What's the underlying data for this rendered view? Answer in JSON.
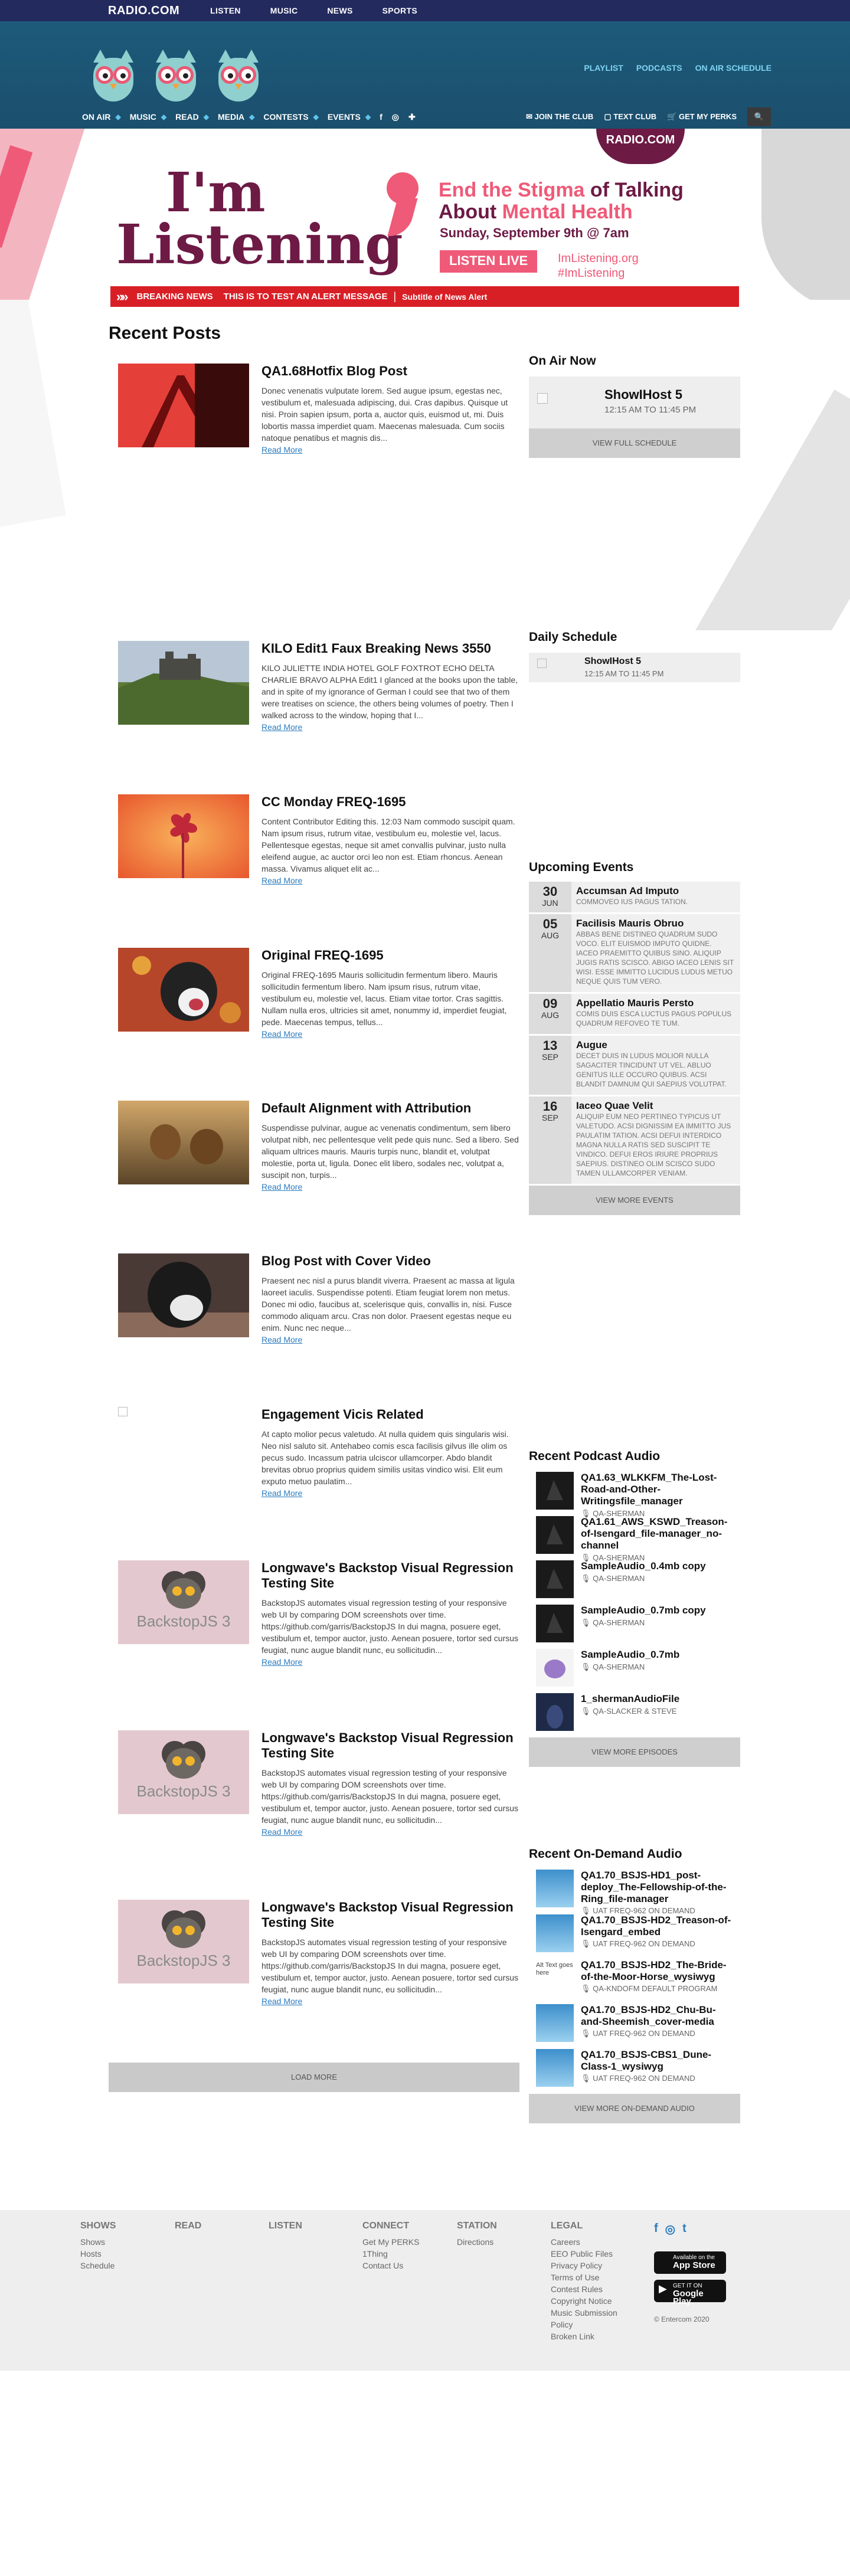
{
  "topbar": {
    "brand": "RADIO.COM",
    "items": [
      "LISTEN",
      "MUSIC",
      "NEWS",
      "SPORTS"
    ]
  },
  "header": {
    "links": [
      "PLAYLIST",
      "PODCASTS",
      "ON AIR SCHEDULE"
    ],
    "nav": [
      "ON AIR",
      "MUSIC",
      "READ",
      "MEDIA",
      "CONTESTS",
      "EVENTS"
    ],
    "social": [
      "f",
      "◎",
      "✚"
    ],
    "right": [
      "JOIN THE CLUB",
      "TEXT CLUB",
      "GET MY PERKS"
    ],
    "search_icon": "🔍"
  },
  "hero": {
    "radio": "RADIO.COM",
    "im": "I'm",
    "listening": "Listening",
    "tag1": "End the Stigma",
    "tag2": " of Talking About ",
    "tag3": "Mental Health",
    "date": "Sunday, September 9th @ 7am",
    "listen_live": "LISTEN LIVE",
    "url1": "ImListening.org",
    "url2": "#ImListening"
  },
  "alert": {
    "label": "BREAKING NEWS",
    "message": "THIS IS TO TEST AN ALERT MESSAGE",
    "separator": "|",
    "subtitle": "Subtitle of News Alert"
  },
  "recent_posts": {
    "title": "Recent Posts",
    "read_more": "Read More",
    "load_more": "LOAD MORE",
    "posts": [
      {
        "title": "QA1.68Hotfix Blog Post",
        "body": "Donec venenatis vulputate lorem. Sed augue ipsum, egestas nec, vestibulum et, malesuada adipiscing, dui. Cras dapibus. Quisque ut nisi. Proin sapien ipsum, porta a, auctor quis, euismod ut, mi. Duis lobortis massa imperdiet quam. Maecenas malesuada. Cum sociis natoque penatibus et magnis dis..."
      },
      {
        "title": "KILO Edit1 Faux Breaking News 3550",
        "body": "KILO JULIETTE INDIA HOTEL GOLF FOXTROT ECHO DELTA CHARLIE BRAVO ALPHA Edit1 I glanced at the books upon the table, and in spite of my ignorance of German I could see that two of them were treatises on science, the others being volumes of poetry. Then I walked across to the window, hoping that I..."
      },
      {
        "title": "CC Monday FREQ-1695",
        "body": "Content Contributor Editing this. 12:03 Nam commodo suscipit quam. Nam ipsum risus, rutrum vitae, vestibulum eu, molestie vel, lacus. Pellentesque egestas, neque sit amet convallis pulvinar, justo nulla eleifend augue, ac auctor orci leo non est. Etiam rhoncus. Aenean massa. Vivamus aliquet elit ac..."
      },
      {
        "title": "Original FREQ-1695",
        "body": "Original FREQ-1695 Mauris sollicitudin fermentum libero. Mauris sollicitudin fermentum libero. Nam ipsum risus, rutrum vitae, vestibulum eu, molestie vel, lacus. Etiam vitae tortor. Cras sagittis. Nullam nulla eros, ultricies sit amet, nonummy id, imperdiet feugiat, pede. Maecenas tempus, tellus..."
      },
      {
        "title": "Default Alignment with Attribution",
        "body": "Suspendisse pulvinar, augue ac venenatis condimentum, sem libero volutpat nibh, nec pellentesque velit pede quis nunc. Sed a libero. Sed aliquam ultrices mauris. Mauris turpis nunc, blandit et, volutpat molestie, porta ut, ligula. Donec elit libero, sodales nec, volutpat a, suscipit non, turpis..."
      },
      {
        "title": "Blog Post with Cover Video",
        "body": "Praesent nec nisl a purus blandit viverra. Praesent ac massa at ligula laoreet iaculis. Suspendisse potenti. Etiam feugiat lorem non metus. Donec mi odio, faucibus at, scelerisque quis, convallis in, nisi. Fusce commodo aliquam arcu. Cras non dolor. Praesent egestas neque eu enim. Nunc nec neque..."
      },
      {
        "title": "Engagement Vicis Related",
        "body": "At capto molior pecus valetudo. At nulla quidem quis singularis wisi. Neo nisl saluto sit. Antehabeo comis esca facilisis gilvus ille olim os pecus sudo. Incassum patria ulciscor ullamcorper. Abdo blandit brevitas obruo proprius quidem similis usitas vindico wisi. Elit eum exputo metuo paulatim..."
      },
      {
        "title": "Longwave's Backstop Visual Regression Testing Site",
        "body": "BackstopJS automates visual regression testing of your responsive web UI by comparing DOM screenshots over time. https://github.com/garris/BackstopJS In dui magna, posuere eget, vestibulum et, tempor auctor, justo. Aenean posuere, tortor sed cursus feugiat, nunc augue blandit nunc, eu sollicitudin..."
      },
      {
        "title": "Longwave's Backstop Visual Regression Testing Site",
        "body": "BackstopJS automates visual regression testing of your responsive web UI by comparing DOM screenshots over time. https://github.com/garris/BackstopJS In dui magna, posuere eget, vestibulum et, tempor auctor, justo. Aenean posuere, tortor sed cursus feugiat, nunc augue blandit nunc, eu sollicitudin..."
      },
      {
        "title": "Longwave's Backstop Visual Regression Testing Site",
        "body": "BackstopJS automates visual regression testing of your responsive web UI by comparing DOM screenshots over time. https://github.com/garris/BackstopJS In dui magna, posuere eget, vestibulum et, tempor auctor, justo. Aenean posuere, tortor sed cursus feugiat, nunc augue blandit nunc, eu sollicitudin..."
      }
    ]
  },
  "backstop_label": "BackstopJS 3",
  "on_air": {
    "title": "On Air Now",
    "show": "ShowIHost 5",
    "time": "12:15 AM TO 11:45 PM",
    "button": "VIEW FULL SCHEDULE"
  },
  "daily_schedule": {
    "title": "Daily Schedule",
    "show": "ShowIHost 5",
    "time": "12:15 AM TO 11:45 PM"
  },
  "events": {
    "title": "Upcoming Events",
    "button": "VIEW MORE EVENTS",
    "items": [
      {
        "day": "30",
        "mon": "JUN",
        "title": "Accumsan Ad Imputo",
        "desc": "COMMOVEO IUS PAGUS TATION."
      },
      {
        "day": "05",
        "mon": "AUG",
        "title": "Facilisis Mauris Obruo",
        "desc": "ABBAS BENE DISTINEO QUADRUM SUDO VOCO. ELIT EUISMOD IMPUTO QUIDNE. IACEO PRAEMITTO QUIBUS SINO. ALIQUIP JUGIS RATIS SCISCO. ABIGO IACEO LENIS SIT WISI. ESSE IMMITTO LUCIDUS LUDUS METUO NEQUE QUIS TUM VERO."
      },
      {
        "day": "09",
        "mon": "AUG",
        "title": "Appellatio Mauris Persto",
        "desc": "COMIS DUIS ESCA LUCTUS PAGUS POPULUS QUADRUM REFOVEO TE TUM."
      },
      {
        "day": "13",
        "mon": "SEP",
        "title": "Augue",
        "desc": "DECET DUIS IN LUDUS MOLIOR NULLA SAGACITER TINCIDUNT UT VEL. ABLUO GENITUS ILLE OCCURO QUIBUS. ACSI BLANDIT DAMNUM QUI SAEPIUS VOLUTPAT."
      },
      {
        "day": "16",
        "mon": "SEP",
        "title": "Iaceo Quae Velit",
        "desc": "ALIQUIP EUM NEO PERTINEO TYPICUS UT VALETUDO. ACSI DIGNISSIM EA IMMITTO JUS PAULATIM TATION. ACSI DEFUI INTERDICO MAGNA NULLA RATIS SED SUSCIPIT TE VINDICO. DEFUI EROS IRIURE PROPRIUS SAEPIUS. DISTINEO OLIM SCISCO SUDO TAMEN ULLAMCORPER VENIAM."
      }
    ]
  },
  "podcasts": {
    "title": "Recent Podcast Audio",
    "button": "VIEW MORE EPISODES",
    "items": [
      {
        "title": "QA1.63_WLKKFM_The-Lost-Road-and-Other-Writingsfile_manager",
        "author": "QA-SHERMAN"
      },
      {
        "title": "QA1.61_AWS_KSWD_Treason-of-Isengard_file-manager_no-channel",
        "author": "QA-SHERMAN"
      },
      {
        "title": "SampleAudio_0.4mb copy",
        "author": "QA-SHERMAN"
      },
      {
        "title": "SampleAudio_0.7mb copy",
        "author": "QA-SHERMAN"
      },
      {
        "title": "SampleAudio_0.7mb",
        "author": "QA-SHERMAN"
      },
      {
        "title": "1_shermanAudioFile",
        "author": "QA-SLACKER & STEVE"
      }
    ]
  },
  "ondemand": {
    "title": "Recent On-Demand Audio",
    "button": "VIEW MORE ON-DEMAND AUDIO",
    "alt": "Alt Text goes here",
    "items": [
      {
        "title": "QA1.70_BSJS-HD1_post-deploy_The-Fellowship-of-the-Ring_file-manager",
        "author": "UAT FREQ-962 ON DEMAND"
      },
      {
        "title": "QA1.70_BSJS-HD2_Treason-of-Isengard_embed",
        "author": "UAT FREQ-962 ON DEMAND"
      },
      {
        "title": "QA1.70_BSJS-HD2_The-Bride-of-the-Moor-Horse_wysiwyg",
        "author": "QA-KNDOFM DEFAULT PROGRAM"
      },
      {
        "title": "QA1.70_BSJS-HD2_Chu-Bu-and-Sheemish_cover-media",
        "author": "UAT FREQ-962 ON DEMAND"
      },
      {
        "title": "QA1.70_BSJS-CBS1_Dune-Class-1_wysiwyg",
        "author": "UAT FREQ-962 ON DEMAND"
      }
    ]
  },
  "footer": {
    "cols": [
      {
        "head": "SHOWS",
        "links": [
          "Shows",
          "Hosts",
          "Schedule"
        ]
      },
      {
        "head": "READ",
        "links": []
      },
      {
        "head": "LISTEN",
        "links": []
      },
      {
        "head": "CONNECT",
        "links": [
          "Get My PERKS",
          "1Thing",
          "Contact Us"
        ]
      },
      {
        "head": "STATION",
        "links": [
          "Directions"
        ]
      },
      {
        "head": "LEGAL",
        "links": [
          "Careers",
          "EEO Public Files",
          "Privacy Policy",
          "Terms of Use",
          "Contest Rules",
          "Copyright Notice",
          "Music Submission Policy",
          "Broken Link"
        ]
      }
    ],
    "social": [
      "f",
      "◎",
      "t"
    ],
    "app_small": "Available on the",
    "app_store": "App Store",
    "play_small": "GET IT ON",
    "play_store": "Google Play",
    "copyright": "© Entercom 2020"
  },
  "colors": {
    "topbar": "#232a5e",
    "header": "#1d5a7a",
    "alert": "#d91f26",
    "brand": "#6d1a45",
    "accent": "#ef5a78",
    "link": "#2c7cbf"
  }
}
